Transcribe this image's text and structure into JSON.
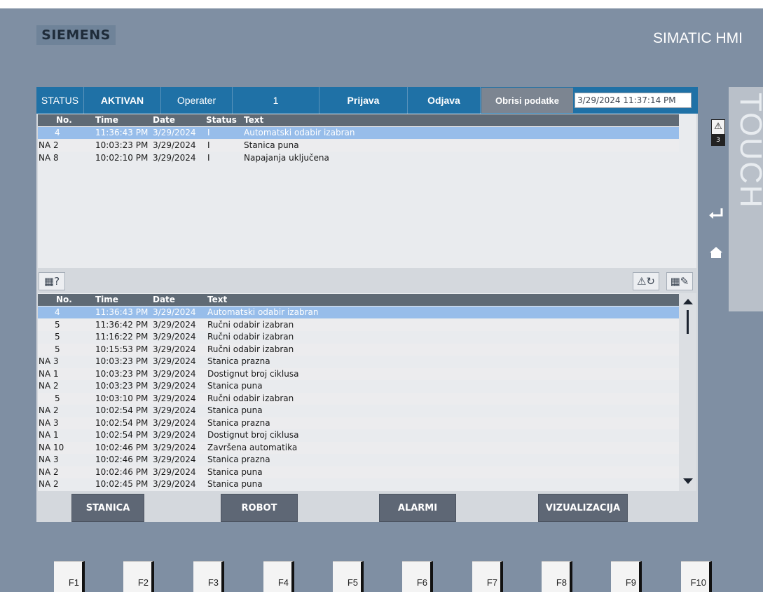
{
  "branding": {
    "logo_text": "SIEMENS",
    "product": "SIMATIC HMI",
    "touch_label": "TOUCH"
  },
  "topbar": {
    "status_label": "STATUS",
    "status_value": "AKTIVAN",
    "user_label": "Operater",
    "user_level": "1",
    "login_button": "Prijava",
    "logout_button": "Odjava",
    "delete_button": "Obrisi podatke",
    "datetime": "3/29/2024 11:37:14 PM"
  },
  "alarm_view": {
    "columns": [
      "No.",
      "Time",
      "Date",
      "Status",
      "Text"
    ],
    "rows": [
      {
        "no": "4",
        "time": "11:36:43 PM",
        "date": "3/29/2024",
        "status": "I",
        "text": "Automatski odabir izabran",
        "selected": true
      },
      {
        "no": "NA 2",
        "time": "10:03:23 PM",
        "date": "3/29/2024",
        "status": "I",
        "text": "Stanica puna"
      },
      {
        "no": "NA 8",
        "time": "10:02:10 PM",
        "date": "3/29/2024",
        "status": "I",
        "text": "Napajanja uključena"
      }
    ]
  },
  "alarm_log": {
    "columns": [
      "No.",
      "Time",
      "Date",
      "Text"
    ],
    "rows": [
      {
        "no": "4",
        "time": "11:36:43 PM",
        "date": "3/29/2024",
        "text": "Automatski odabir izabran",
        "selected": true
      },
      {
        "no": "5",
        "time": "11:36:42 PM",
        "date": "3/29/2024",
        "text": "Ručni odabir izabran"
      },
      {
        "no": "5",
        "time": "11:16:22 PM",
        "date": "3/29/2024",
        "text": "Ručni odabir izabran"
      },
      {
        "no": "5",
        "time": "10:15:53 PM",
        "date": "3/29/2024",
        "text": "Ručni odabir izabran"
      },
      {
        "no": "NA 3",
        "time": "10:03:23 PM",
        "date": "3/29/2024",
        "text": "Stanica prazna"
      },
      {
        "no": "NA 1",
        "time": "10:03:23 PM",
        "date": "3/29/2024",
        "text": "Dostignut broj ciklusa"
      },
      {
        "no": "NA 2",
        "time": "10:03:23 PM",
        "date": "3/29/2024",
        "text": "Stanica puna"
      },
      {
        "no": "5",
        "time": "10:03:10 PM",
        "date": "3/29/2024",
        "text": "Ručni odabir izabran"
      },
      {
        "no": "NA 2",
        "time": "10:02:54 PM",
        "date": "3/29/2024",
        "text": "Stanica puna"
      },
      {
        "no": "NA 3",
        "time": "10:02:54 PM",
        "date": "3/29/2024",
        "text": "Stanica prazna"
      },
      {
        "no": "NA 1",
        "time": "10:02:54 PM",
        "date": "3/29/2024",
        "text": "Dostignut broj ciklusa"
      },
      {
        "no": "NA 10",
        "time": "10:02:46 PM",
        "date": "3/29/2024",
        "text": "Završena automatika"
      },
      {
        "no": "NA 3",
        "time": "10:02:46 PM",
        "date": "3/29/2024",
        "text": "Stanica prazna"
      },
      {
        "no": "NA 2",
        "time": "10:02:46 PM",
        "date": "3/29/2024",
        "text": "Stanica puna"
      },
      {
        "no": "NA 2",
        "time": "10:02:45 PM",
        "date": "3/29/2024",
        "text": "Stanica puna"
      }
    ]
  },
  "nav": {
    "stanica": "STANICA",
    "robot": "ROBOT",
    "alarmi": "ALARMI",
    "vizualizacija": "VIZUALIZACIJA"
  },
  "side": {
    "alarm_count": "3",
    "alarm_icon": "warning-icon",
    "enter_icon": "enter-icon",
    "home_icon": "home-icon"
  },
  "icons": {
    "info": "table-help-icon",
    "ack": "acknowledge-icon",
    "edit": "table-edit-icon"
  },
  "function_keys": [
    "F1",
    "F2",
    "F3",
    "F4",
    "F5",
    "F6",
    "F7",
    "F8",
    "F9",
    "F10"
  ]
}
